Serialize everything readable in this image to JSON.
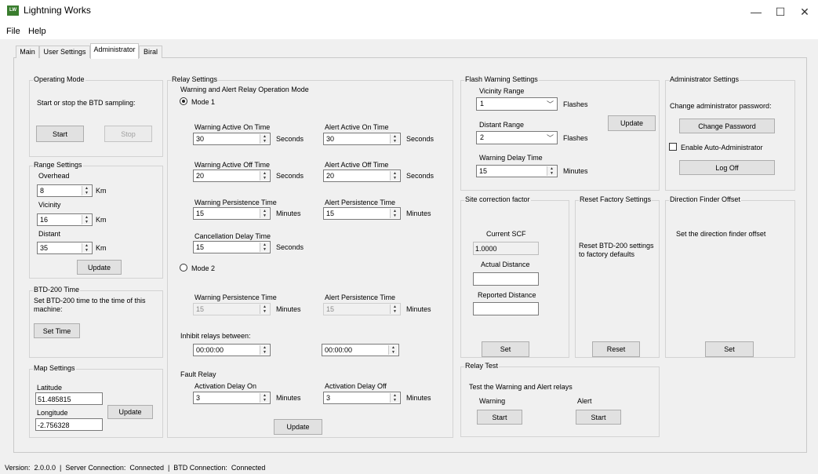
{
  "window": {
    "title": "Lightning Works",
    "app_icon_text": "LW",
    "minimize": "—",
    "maximize": "☐",
    "close": "✕"
  },
  "menu": {
    "file": "File",
    "help": "Help"
  },
  "tabs": {
    "main": "Main",
    "user_settings": "User Settings",
    "administrator": "Administrator",
    "biral": "Biral"
  },
  "operating_mode": {
    "title": "Operating Mode",
    "description": "Start or stop the BTD sampling:",
    "start": "Start",
    "stop": "Stop"
  },
  "range_settings": {
    "title": "Range Settings",
    "overhead_label": "Overhead",
    "overhead_value": "8",
    "vicinity_label": "Vicinity",
    "vicinity_value": "16",
    "distant_label": "Distant",
    "distant_value": "35",
    "unit": "Km",
    "update": "Update"
  },
  "btd_time": {
    "title": "BTD-200 Time",
    "description": "Set BTD-200 time to the time of this machine:",
    "set_time": "Set Time"
  },
  "map_settings": {
    "title": "Map Settings",
    "latitude_label": "Latitude",
    "latitude_value": "51.485815",
    "longitude_label": "Longitude",
    "longitude_value": "-2.756328",
    "update": "Update"
  },
  "relay_settings": {
    "title": "Relay Settings",
    "mode_heading": "Warning and Alert Relay Operation Mode",
    "mode1_label": "Mode 1",
    "mode2_label": "Mode 2",
    "warning_active_on_label": "Warning Active On Time",
    "warning_active_on_value": "30",
    "alert_active_on_label": "Alert Active On Time",
    "alert_active_on_value": "30",
    "warning_active_off_label": "Warning Active Off Time",
    "warning_active_off_value": "20",
    "alert_active_off_label": "Alert Active Off Time",
    "alert_active_off_value": "20",
    "warning_persistence_label": "Warning Persistence Time",
    "warning_persistence_value": "15",
    "alert_persistence_label": "Alert Persistence Time",
    "alert_persistence_value": "15",
    "cancellation_delay_label": "Cancellation Delay Time",
    "cancellation_delay_value": "15",
    "m2_warning_persistence_label": "Warning Persistence Time",
    "m2_warning_persistence_value": "15",
    "m2_alert_persistence_label": "Alert Persistence Time",
    "m2_alert_persistence_value": "15",
    "inhibit_label": "Inhibit relays between:",
    "inhibit_start": "00:00:00",
    "inhibit_end": "00:00:00",
    "fault_relay_label": "Fault Relay",
    "activation_on_label": "Activation Delay On",
    "activation_on_value": "3",
    "activation_off_label": "Activation Delay Off",
    "activation_off_value": "3",
    "seconds": "Seconds",
    "minutes": "Minutes",
    "update": "Update"
  },
  "flash_warning": {
    "title": "Flash Warning Settings",
    "vicinity_range_label": "Vicinity Range",
    "vicinity_range_value": "1",
    "distant_range_label": "Distant Range",
    "distant_range_value": "2",
    "flashes": "Flashes",
    "warning_delay_label": "Warning Delay Time",
    "warning_delay_value": "15",
    "minutes": "Minutes",
    "update": "Update"
  },
  "admin_settings": {
    "title": "Administrator Settings",
    "change_password_prompt": "Change administrator password:",
    "change_password": "Change Password",
    "auto_admin": "Enable Auto-Administrator",
    "log_off": "Log Off"
  },
  "site_correction": {
    "title": "Site correction factor",
    "current_scf_label": "Current SCF",
    "current_scf_value": "1.0000",
    "actual_distance_label": "Actual Distance",
    "reported_distance_label": "Reported Distance",
    "set": "Set"
  },
  "reset_factory": {
    "title": "Reset Factory Settings",
    "description": "Reset BTD-200 settings to factory defaults",
    "reset": "Reset"
  },
  "direction_finder": {
    "title": "Direction Finder Offset",
    "description": "Set the direction finder offset",
    "set": "Set"
  },
  "relay_test": {
    "title": "Relay Test",
    "description": "Test the Warning and Alert relays",
    "warning_label": "Warning",
    "alert_label": "Alert",
    "start": "Start"
  },
  "status": {
    "text": "Version:  2.0.0.0  |  Server Connection:  Connected  |  BTD Connection:  Connected"
  }
}
